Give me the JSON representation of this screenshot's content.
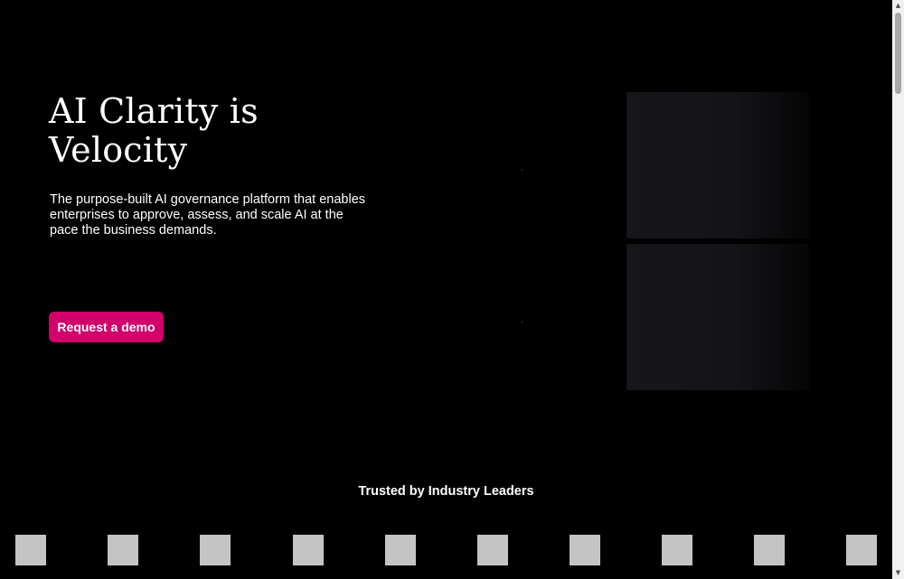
{
  "hero": {
    "title": "AI Clarity is Velocity",
    "subtitle": "The purpose-built AI governance platform that enables enterprises to approve, assess, and scale AI at the pace the business demands.",
    "cta_label": "Request a demo"
  },
  "trusted": {
    "heading": "Trusted by Industry Leaders",
    "logo_count": 10
  },
  "colors": {
    "background": "#000000",
    "accent": "#d1006b",
    "panel": "#16161b",
    "logo_placeholder": "#c4c4c4"
  },
  "scrollbar": {
    "up_icon": "arrow-up-icon",
    "down_icon": "arrow-down-icon"
  }
}
